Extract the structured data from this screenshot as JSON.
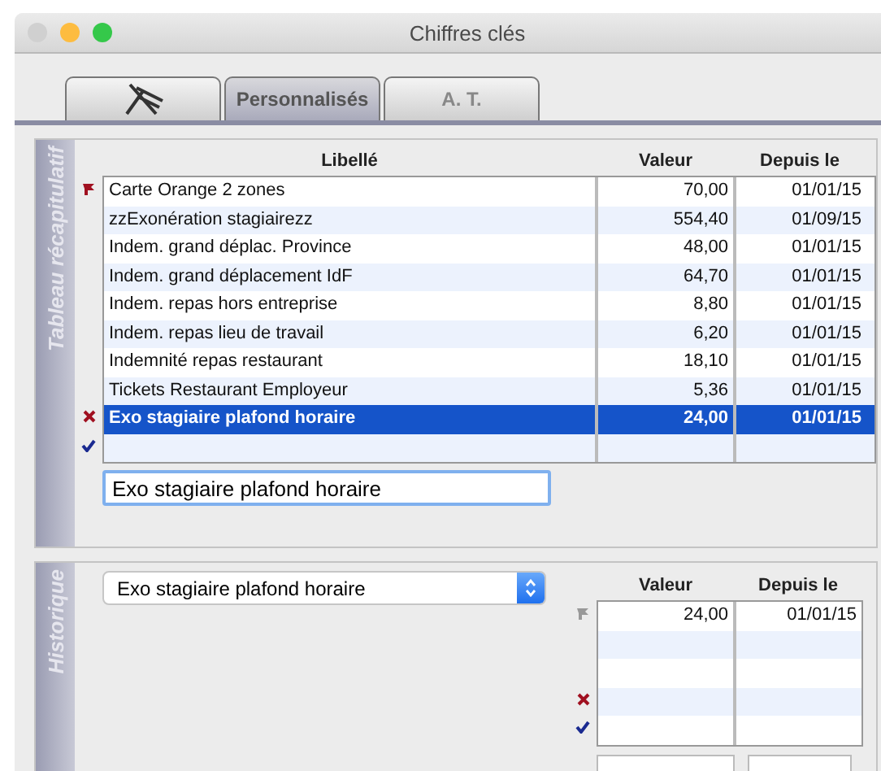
{
  "window": {
    "title": "Chiffres clés"
  },
  "tabs": [
    {
      "kind": "icon",
      "selected": false
    },
    {
      "kind": "text",
      "label": "Personnalisés",
      "selected": true
    },
    {
      "kind": "text",
      "label": "A. T.",
      "selected": false
    }
  ],
  "summary": {
    "title": "Tableau récapitulatif",
    "columns": [
      "Libellé",
      "Valeur",
      "Depuis le"
    ],
    "rows": [
      {
        "label": "Carte Orange 2 zones",
        "value": "70,00",
        "date": "01/01/15",
        "selected": false
      },
      {
        "label": "zzExonération stagiairezz",
        "value": "554,40",
        "date": "01/09/15",
        "selected": false
      },
      {
        "label": "Indem. grand déplac. Province",
        "value": "48,00",
        "date": "01/01/15",
        "selected": false
      },
      {
        "label": "Indem. grand déplacement IdF",
        "value": "64,70",
        "date": "01/01/15",
        "selected": false
      },
      {
        "label": "Indem. repas hors entreprise",
        "value": "8,80",
        "date": "01/01/15",
        "selected": false
      },
      {
        "label": "Indem. repas lieu de travail",
        "value": "6,20",
        "date": "01/01/15",
        "selected": false
      },
      {
        "label": "Indemnité repas restaurant",
        "value": "18,10",
        "date": "01/01/15",
        "selected": false
      },
      {
        "label": "Tickets Restaurant Employeur",
        "value": "5,36",
        "date": "01/01/15",
        "selected": false
      },
      {
        "label": "Exo stagiaire plafond horaire",
        "value": "24,00",
        "date": "01/01/15",
        "selected": true
      }
    ],
    "edit_field": {
      "value": "Exo stagiaire plafond horaire"
    }
  },
  "history": {
    "title": "Historique",
    "select": {
      "value": "Exo stagiaire plafond horaire"
    },
    "columns": [
      "Valeur",
      "Depuis le"
    ],
    "rows": [
      {
        "value": "24,00",
        "date": "01/01/15"
      }
    ]
  }
}
